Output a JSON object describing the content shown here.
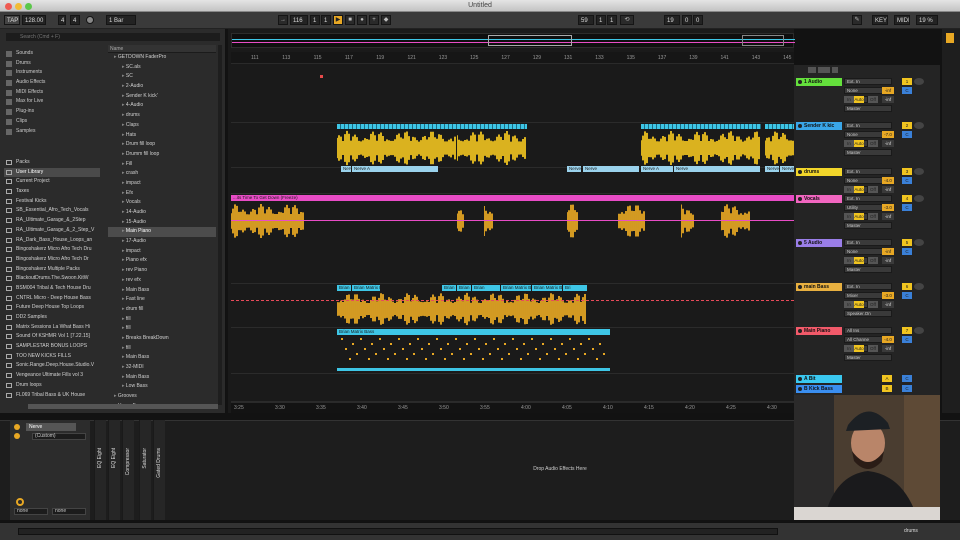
{
  "window": {
    "title": "Untitled"
  },
  "transport": {
    "tap": "TAP",
    "tempo": "128.00",
    "meter_num": "4",
    "meter_den": "4",
    "quant": "1 Bar",
    "pos_bar": "116",
    "pos_beat": "1",
    "pos_sixteenth": "1",
    "loop_bar": "59",
    "loop_beat": "1",
    "loop_sixteenth": "1",
    "len_bar": "19",
    "len_beat": "0",
    "len_sixteenth": "0",
    "key": "KEY",
    "midi": "MIDI",
    "cpu": "19 %"
  },
  "browser": {
    "search_placeholder": "Search (Cmd + F)",
    "categories": [
      {
        "label": "Sounds"
      },
      {
        "label": "Drums"
      },
      {
        "label": "Instruments"
      },
      {
        "label": "Audio Effects"
      },
      {
        "label": "MIDI Effects"
      },
      {
        "label": "Max for Live"
      },
      {
        "label": "Plug-ins"
      },
      {
        "label": "Clips"
      },
      {
        "label": "Samples"
      }
    ],
    "places": [
      {
        "label": "Packs"
      },
      {
        "label": "User Library"
      },
      {
        "label": "Current Project"
      },
      {
        "label": "Taxes"
      },
      {
        "label": "Festival Kicks"
      },
      {
        "label": "SB_Essential_Afro_Tech_Vocals"
      },
      {
        "label": "RA_Ultimate_Garage_&_2Step"
      },
      {
        "label": "RA_Ultimate_Garage_&_2_Step_V"
      },
      {
        "label": "RA_Dark_Bass_House_Loops_an"
      },
      {
        "label": "Bingoshakerz Micro Afro Tech Dru"
      },
      {
        "label": "Bingoshakerz Micro Afro Tech Dr"
      },
      {
        "label": "Bingoshakerz Multiple Packs"
      },
      {
        "label": "BlackoutDrums.The.Swoon.KitW"
      },
      {
        "label": "BSM004 Tribal & Tech House Dru"
      },
      {
        "label": "CNTRL Micro - Deep House Bass"
      },
      {
        "label": "Future Deep House Top Loops"
      },
      {
        "label": "DD2 Samples"
      },
      {
        "label": "Matrix Sessions La What Bass Hi"
      },
      {
        "label": "Sound Of KSHMR Vol 1 [7.22.15]"
      },
      {
        "label": "SAMPLESTAR BONUS LOOPS"
      },
      {
        "label": "TOO NEW KICKS FILLS"
      },
      {
        "label": "Sonic.Range.Deep.House.Studio.V"
      },
      {
        "label": "Vengeance Ultimate Fills vol 3"
      },
      {
        "label": "Drum loops"
      },
      {
        "label": "FL069 Tribal Bass & UK House"
      }
    ],
    "name_header": "Name",
    "files": [
      {
        "label": "GETDOWN FaderPro",
        "indent": 0
      },
      {
        "label": "SC.als",
        "indent": 1
      },
      {
        "label": "SC",
        "indent": 1
      },
      {
        "label": "2-Audio",
        "indent": 1
      },
      {
        "label": "Sender K kick'",
        "indent": 1
      },
      {
        "label": "4-Audio",
        "indent": 1
      },
      {
        "label": "drums",
        "indent": 1
      },
      {
        "label": "Claps",
        "indent": 1
      },
      {
        "label": "Hats",
        "indent": 1
      },
      {
        "label": "Drum fill loop",
        "indent": 1
      },
      {
        "label": "Drumm fill loop",
        "indent": 1
      },
      {
        "label": "Fill",
        "indent": 1
      },
      {
        "label": "crash",
        "indent": 1
      },
      {
        "label": "impact",
        "indent": 1
      },
      {
        "label": "Efx",
        "indent": 1
      },
      {
        "label": "Vocals",
        "indent": 1
      },
      {
        "label": "14-Audio",
        "indent": 1
      },
      {
        "label": "15-Audio",
        "indent": 1
      },
      {
        "label": "Main Piano",
        "indent": 1
      },
      {
        "label": "17-Audio",
        "indent": 1
      },
      {
        "label": "impact",
        "indent": 1
      },
      {
        "label": "Piano efx",
        "indent": 1
      },
      {
        "label": "rev Piano",
        "indent": 1
      },
      {
        "label": "rev efx",
        "indent": 1
      },
      {
        "label": "Main Bass",
        "indent": 1
      },
      {
        "label": "Fast line",
        "indent": 1
      },
      {
        "label": "drum fill",
        "indent": 1
      },
      {
        "label": "fill",
        "indent": 1
      },
      {
        "label": "fill",
        "indent": 1
      },
      {
        "label": "Breaks BreakDown",
        "indent": 1
      },
      {
        "label": "fill",
        "indent": 1
      },
      {
        "label": "Main Bass",
        "indent": 1
      },
      {
        "label": "32-MIDI",
        "indent": 1
      },
      {
        "label": "Main Bass",
        "indent": 1
      },
      {
        "label": "Low Bass",
        "indent": 1
      },
      {
        "label": "Grooves",
        "indent": 0
      },
      {
        "label": "Henry Fong",
        "indent": 0
      }
    ]
  },
  "ruler": {
    "labels": [
      "111",
      "113",
      "115",
      "117",
      "119",
      "121",
      "123",
      "125",
      "127",
      "129",
      "131",
      "133",
      "135",
      "137",
      "139",
      "141",
      "143",
      "145"
    ]
  },
  "timebar": {
    "labels": [
      "3:25",
      "3:30",
      "3:35",
      "3:40",
      "3:45",
      "3:50",
      "3:55",
      "4:00",
      "4:05",
      "4:10",
      "4:15",
      "4:20",
      "4:25",
      "4:30"
    ]
  },
  "clips": {
    "sender_k": [
      "Nerve",
      "Nerve A",
      "Nerve A",
      "Nerve",
      "Nerve A",
      "Nerve",
      "Nerve A",
      "Nerve"
    ],
    "vocal_clip": "...its Time To Get Down (Freeze)",
    "bass_clips": [
      "Brian",
      "Brian Matrix Bass",
      "Brian",
      "Brian Matrix Bass",
      "Brian",
      "Brian Matrix Bass (Freeze)",
      "Brian Matrix Bass",
      "Bri"
    ],
    "midi_clip": "Brian Matrix Bass"
  },
  "mixer": {
    "tracks": [
      {
        "name": "1 Audio",
        "color": "#64e03c",
        "in": "Ext. In",
        "sub": "None",
        "ch": "1",
        "out": "Master",
        "num": "1",
        "vol": "-inf",
        "vol2": "-inf"
      },
      {
        "name": "Sender K kic",
        "color": "#3aa6e8",
        "in": "Ext. In",
        "sub": "None",
        "ch": "2",
        "out": "Master",
        "num": "2",
        "vol": "-7.0",
        "vol2": "-inf"
      },
      {
        "name": "drums",
        "color": "#f2d62a",
        "in": "Ext. In",
        "sub": "None",
        "ch": "",
        "out": "Master",
        "num": "3",
        "vol": "-4.0",
        "vol2": "-inf"
      },
      {
        "name": "Vocals",
        "color": "#f266c0",
        "in": "Ext. In",
        "sub": "Utility",
        "ch": "Gain",
        "out": "Master",
        "num": "4",
        "vol": "-3.0",
        "vol2": "-inf"
      },
      {
        "name": "5 Audio",
        "color": "#9a7ee8",
        "in": "Ext. In",
        "sub": "None",
        "ch": "2",
        "out": "Master",
        "num": "5",
        "vol": "-inf",
        "vol2": "-inf"
      },
      {
        "name": "main Bass",
        "color": "#e8b040",
        "in": "Ext. In",
        "sub": "Mixer",
        "ch": "2",
        "out": "Speaker.On",
        "num": "6",
        "vol": "-3.0",
        "vol2": "-inf"
      },
      {
        "name": "Main Piano",
        "color": "#f25a6a",
        "in": "All Ins",
        "sub": "All Channe",
        "ch": "",
        "out": "Master",
        "num": "7",
        "vol": "-4.0",
        "vol2": "-inf"
      },
      {
        "name": "A Bit",
        "color": "#3ac8f0",
        "in": "",
        "sub": "",
        "ch": "",
        "out": "",
        "num": "A",
        "vol": "",
        "vol2": ""
      },
      {
        "name": "B Kick Bass",
        "color": "#3a8ef0",
        "in": "",
        "sub": "",
        "ch": "",
        "out": "",
        "num": "B",
        "vol": "",
        "vol2": ""
      }
    ],
    "btn_in": "In",
    "btn_auto": "Auto",
    "btn_off": "Off",
    "btn_c": "C"
  },
  "device": {
    "track_name": "Nerve",
    "preset": "(Custom)",
    "none1": "none",
    "none2": "none",
    "strips": [
      "EQ Eight",
      "EQ Eight",
      "Compressor",
      "Saturator",
      "Gated Drums"
    ],
    "drop_text": "Drop Audio Effects Here"
  },
  "bottombar": {
    "track": "drums"
  },
  "colors": {
    "orange": "#e8a824",
    "cyan": "#3ec6e6",
    "pink": "#e84cc6",
    "yellow": "#f0c420"
  }
}
